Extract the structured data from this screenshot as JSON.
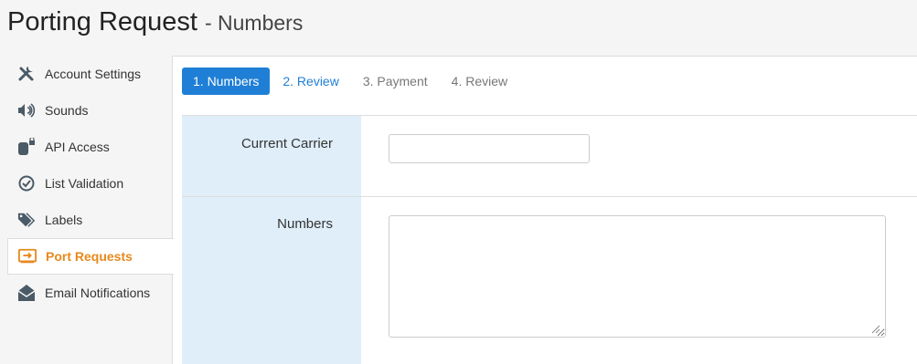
{
  "header": {
    "title": "Porting Request",
    "subtitle": "- Numbers"
  },
  "sidebar": {
    "items": [
      {
        "label": "Account Settings",
        "icon": "wrench-icon"
      },
      {
        "label": "Sounds",
        "icon": "speaker-icon"
      },
      {
        "label": "API Access",
        "icon": "database-lock-icon"
      },
      {
        "label": "List Validation",
        "icon": "check-circle-icon"
      },
      {
        "label": "Labels",
        "icon": "tags-icon"
      },
      {
        "label": "Port Requests",
        "icon": "port-transfer-icon",
        "active": true
      },
      {
        "label": "Email Notifications",
        "icon": "envelope-open-icon"
      }
    ]
  },
  "tabs": [
    {
      "label": "1. Numbers",
      "state": "active"
    },
    {
      "label": "2. Review",
      "state": "link"
    },
    {
      "label": "3. Payment",
      "state": "disabled"
    },
    {
      "label": "4. Review",
      "state": "disabled"
    }
  ],
  "form": {
    "current_carrier_label": "Current Carrier",
    "current_carrier_value": "",
    "numbers_label": "Numbers",
    "numbers_value": ""
  },
  "colors": {
    "accent": "#1f7fd6",
    "active_sidebar": "#e8891c",
    "label_bg": "#dfeef9"
  }
}
